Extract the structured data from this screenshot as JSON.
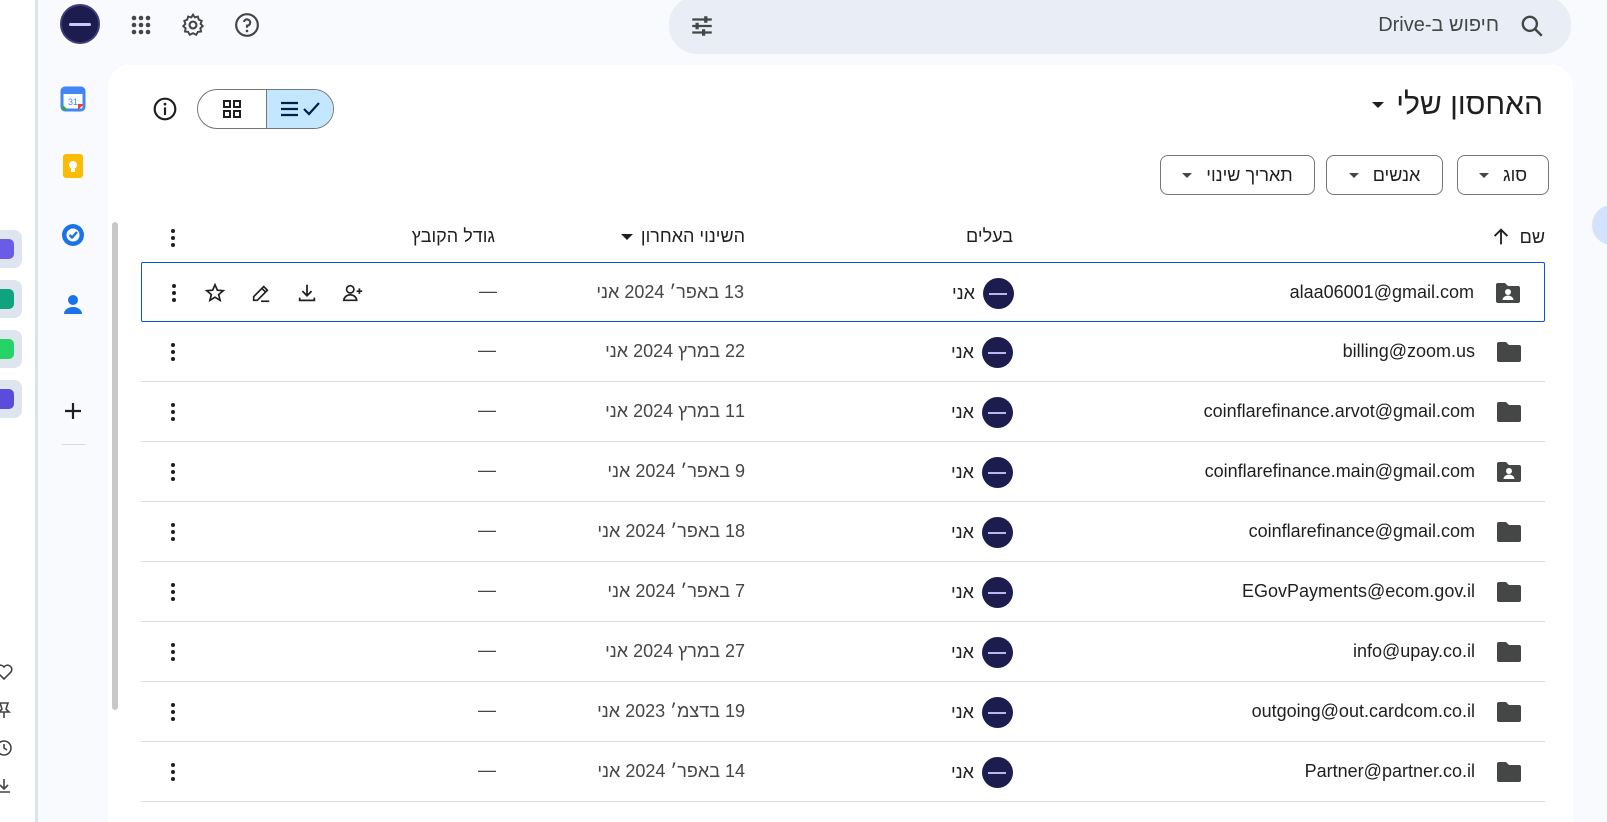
{
  "search": {
    "placeholder": "חיפוש ב-Drive"
  },
  "header": {
    "title": "האחסון שלי"
  },
  "filters": {
    "type": "סוג",
    "people": "אנשים",
    "modified": "תאריך שינוי"
  },
  "columns": {
    "name": "שם",
    "owner": "בעלים",
    "modified": "השינוי האחרון",
    "size": "גודל הקובץ"
  },
  "rows": [
    {
      "name": "alaa06001@gmail.com",
      "icon": "shared-folder-icon",
      "owner": "אני",
      "modified": "13 באפר׳ 2024 אני",
      "size": "—"
    },
    {
      "name": "billing@zoom.us",
      "icon": "folder-icon",
      "owner": "אני",
      "modified": "22 במרץ 2024 אני",
      "size": "—"
    },
    {
      "name": "coinflarefinance.arvot@gmail.com",
      "icon": "folder-icon",
      "owner": "אני",
      "modified": "11 במרץ 2024 אני",
      "size": "—"
    },
    {
      "name": "coinflarefinance.main@gmail.com",
      "icon": "shared-folder-icon",
      "owner": "אני",
      "modified": "9 באפר׳ 2024 אני",
      "size": "—"
    },
    {
      "name": "coinflarefinance@gmail.com",
      "icon": "folder-icon",
      "owner": "אני",
      "modified": "18 באפר׳ 2024 אני",
      "size": "—"
    },
    {
      "name": "EGovPayments@ecom.gov.il",
      "icon": "folder-icon",
      "owner": "אני",
      "modified": "7 באפר׳ 2024 אני",
      "size": "—"
    },
    {
      "name": "info@upay.co.il",
      "icon": "folder-icon",
      "owner": "אני",
      "modified": "27 במרץ 2024 אני",
      "size": "—"
    },
    {
      "name": "outgoing@out.cardcom.co.il",
      "icon": "folder-icon",
      "owner": "אני",
      "modified": "19 בדצמ׳ 2023 אני",
      "size": "—"
    },
    {
      "name": "Partner@partner.co.il",
      "icon": "folder-icon",
      "owner": "אני",
      "modified": "14 באפר׳ 2024 אני",
      "size": "—"
    }
  ],
  "colors": {
    "accent": "#0b57d0",
    "selected_view": "#c2e7ff",
    "search_bg": "#e9eef6"
  }
}
